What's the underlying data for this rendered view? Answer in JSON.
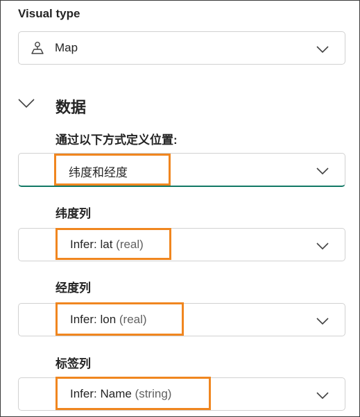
{
  "visual_type": {
    "label": "Visual type",
    "value": "Map",
    "icon": "map-pin-icon"
  },
  "section": {
    "title": "数据",
    "expanded": true
  },
  "location": {
    "label": "通过以下方式定义位置:",
    "value": "纬度和经度"
  },
  "latitude": {
    "label": "纬度列",
    "value_prefix": "Infer: lat",
    "value_hint": "(real)"
  },
  "longitude": {
    "label": "经度列",
    "value_prefix": "Infer: lon",
    "value_hint": "(real)"
  },
  "label_column": {
    "label": "标签列",
    "value_prefix": "Infer: Name",
    "value_hint": "(string)"
  },
  "colors": {
    "highlight": "#f0861f",
    "accent": "#117865"
  }
}
